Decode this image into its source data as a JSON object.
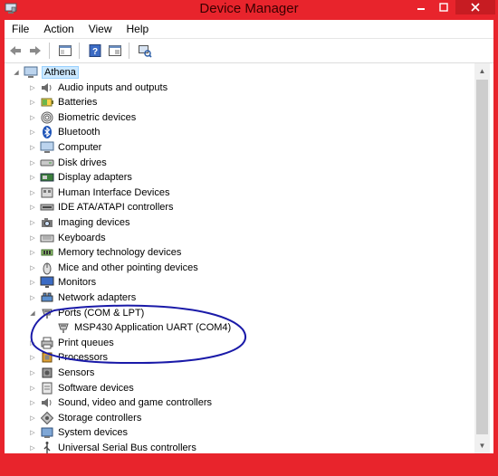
{
  "window": {
    "title": "Device Manager"
  },
  "menu": [
    "File",
    "Action",
    "View",
    "Help"
  ],
  "toolbar": [
    "back-icon",
    "forward-icon",
    "properties-panel-icon",
    "help-icon",
    "update-driver-icon",
    "scan-hardware-icon"
  ],
  "tree": {
    "root": {
      "label": "Athena",
      "icon": "computer-icon"
    },
    "items": [
      {
        "label": "Audio inputs and outputs",
        "icon": "speaker-icon"
      },
      {
        "label": "Batteries",
        "icon": "battery-icon"
      },
      {
        "label": "Biometric devices",
        "icon": "fingerprint-icon"
      },
      {
        "label": "Bluetooth",
        "icon": "bluetooth-icon"
      },
      {
        "label": "Computer",
        "icon": "computer-icon"
      },
      {
        "label": "Disk drives",
        "icon": "disk-drive-icon"
      },
      {
        "label": "Display adapters",
        "icon": "display-adapter-icon"
      },
      {
        "label": "Human Interface Devices",
        "icon": "hid-icon"
      },
      {
        "label": "IDE ATA/ATAPI controllers",
        "icon": "ide-controller-icon"
      },
      {
        "label": "Imaging devices",
        "icon": "camera-icon"
      },
      {
        "label": "Keyboards",
        "icon": "keyboard-icon"
      },
      {
        "label": "Memory technology devices",
        "icon": "memory-icon"
      },
      {
        "label": "Mice and other pointing devices",
        "icon": "mouse-icon"
      },
      {
        "label": "Monitors",
        "icon": "monitor-icon"
      },
      {
        "label": "Network adapters",
        "icon": "network-adapter-icon"
      },
      {
        "label": "Ports (COM & LPT)",
        "icon": "port-icon",
        "expanded": true,
        "children": [
          {
            "label": "MSP430 Application UART (COM4)",
            "icon": "port-icon"
          }
        ]
      },
      {
        "label": "Print queues",
        "icon": "printer-icon"
      },
      {
        "label": "Processors",
        "icon": "processor-icon"
      },
      {
        "label": "Sensors",
        "icon": "sensor-icon"
      },
      {
        "label": "Software devices",
        "icon": "software-device-icon"
      },
      {
        "label": "Sound, video and game controllers",
        "icon": "speaker-icon"
      },
      {
        "label": "Storage controllers",
        "icon": "storage-controller-icon"
      },
      {
        "label": "System devices",
        "icon": "system-device-icon"
      },
      {
        "label": "Universal Serial Bus controllers",
        "icon": "usb-icon"
      }
    ]
  },
  "colors": {
    "frame": "#e8242c",
    "close_button": "#c71c22",
    "selection": "#cce8ff",
    "annotation": "#1a1aa8"
  }
}
